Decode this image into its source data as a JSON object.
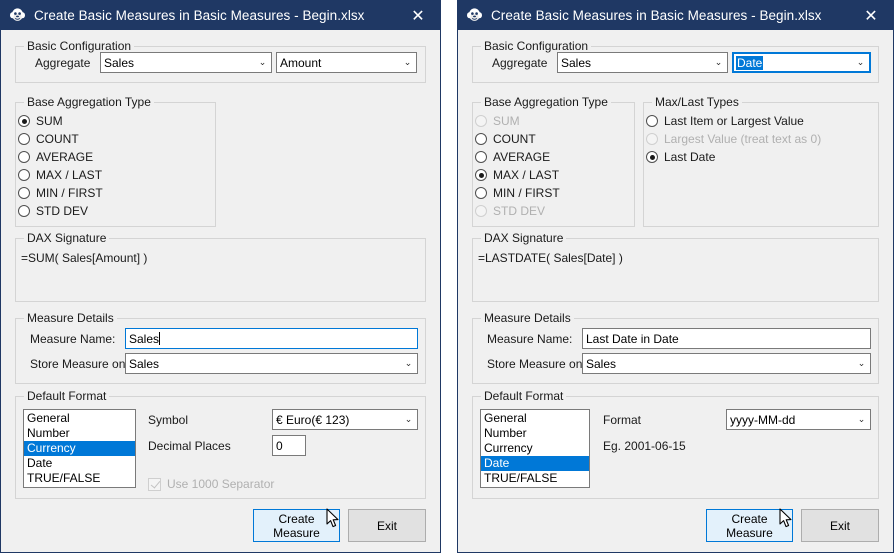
{
  "colors": {
    "titlebar": "#1f3864",
    "accent": "#0078d7",
    "dialog_bg": "#f0f0f0",
    "disabled_text": "#b0b0b0"
  },
  "left_window": {
    "title": "Create Basic Measures in Basic Measures - Begin.xlsx",
    "icon": "monkey-app-icon",
    "close_label": "✕",
    "basic_configuration": {
      "legend": "Basic Configuration",
      "aggregate_label": "Aggregate",
      "table_combo": {
        "value": "Sales",
        "chevron": "⌄"
      },
      "column_combo": {
        "value": "Amount",
        "chevron": "⌄"
      }
    },
    "base_aggregation": {
      "legend": "Base Aggregation Type",
      "options": [
        {
          "label": "SUM",
          "checked": true,
          "disabled": false
        },
        {
          "label": "COUNT",
          "checked": false,
          "disabled": false
        },
        {
          "label": "AVERAGE",
          "checked": false,
          "disabled": false
        },
        {
          "label": "MAX / LAST",
          "checked": false,
          "disabled": false
        },
        {
          "label": "MIN / FIRST",
          "checked": false,
          "disabled": false
        },
        {
          "label": "STD DEV",
          "checked": false,
          "disabled": false
        }
      ]
    },
    "dax_signature": {
      "legend": "DAX Signature",
      "text": "=SUM( Sales[Amount] )"
    },
    "measure_details": {
      "legend": "Measure Details",
      "name_label": "Measure Name:",
      "name_value": "Sales",
      "store_label": "Store Measure on...",
      "store_value": "Sales",
      "store_chevron": "⌄"
    },
    "default_format": {
      "legend": "Default Format",
      "list": [
        "General",
        "Number",
        "Currency",
        "Date",
        "TRUE/FALSE"
      ],
      "selected": "Currency",
      "symbol_label": "Symbol",
      "symbol_value": "€ Euro(€ 123)",
      "symbol_chevron": "⌄",
      "decimal_label": "Decimal Places",
      "decimal_value": "0",
      "separator_label": "Use 1000 Separator",
      "separator_checked": true,
      "separator_disabled": true
    },
    "buttons": {
      "create_line1": "Create",
      "create_line2": "Measure",
      "exit": "Exit"
    }
  },
  "right_window": {
    "title": "Create Basic Measures in Basic Measures - Begin.xlsx",
    "icon": "monkey-app-icon",
    "close_label": "✕",
    "basic_configuration": {
      "legend": "Basic Configuration",
      "aggregate_label": "Aggregate",
      "table_combo": {
        "value": "Sales",
        "chevron": "⌄"
      },
      "column_combo": {
        "value": "Date",
        "chevron": "⌄",
        "text_selected": true,
        "focused": true
      }
    },
    "base_aggregation": {
      "legend": "Base Aggregation Type",
      "options": [
        {
          "label": "SUM",
          "checked": false,
          "disabled": true
        },
        {
          "label": "COUNT",
          "checked": false,
          "disabled": false
        },
        {
          "label": "AVERAGE",
          "checked": false,
          "disabled": false
        },
        {
          "label": "MAX / LAST",
          "checked": true,
          "disabled": false
        },
        {
          "label": "MIN / FIRST",
          "checked": false,
          "disabled": false
        },
        {
          "label": "STD DEV",
          "checked": false,
          "disabled": true
        }
      ]
    },
    "max_last_types": {
      "legend": "Max/Last Types",
      "options": [
        {
          "label": "Last Item or Largest Value",
          "checked": false,
          "disabled": false
        },
        {
          "label": "Largest Value (treat text as 0)",
          "checked": false,
          "disabled": true
        },
        {
          "label": "Last Date",
          "checked": true,
          "disabled": false
        }
      ]
    },
    "dax_signature": {
      "legend": "DAX Signature",
      "text": "=LASTDATE( Sales[Date] )"
    },
    "measure_details": {
      "legend": "Measure Details",
      "name_label": "Measure Name:",
      "name_value": "Last Date in Date",
      "store_label": "Store Measure on...",
      "store_value": "Sales",
      "store_chevron": "⌄"
    },
    "default_format": {
      "legend": "Default Format",
      "list": [
        "General",
        "Number",
        "Currency",
        "Date",
        "TRUE/FALSE"
      ],
      "selected": "Date",
      "format_label": "Format",
      "format_value": "yyyy-MM-dd",
      "format_chevron": "⌄",
      "example_text": "Eg. 2001-06-15"
    },
    "buttons": {
      "create_line1": "Create",
      "create_line2": "Measure",
      "exit": "Exit"
    }
  }
}
